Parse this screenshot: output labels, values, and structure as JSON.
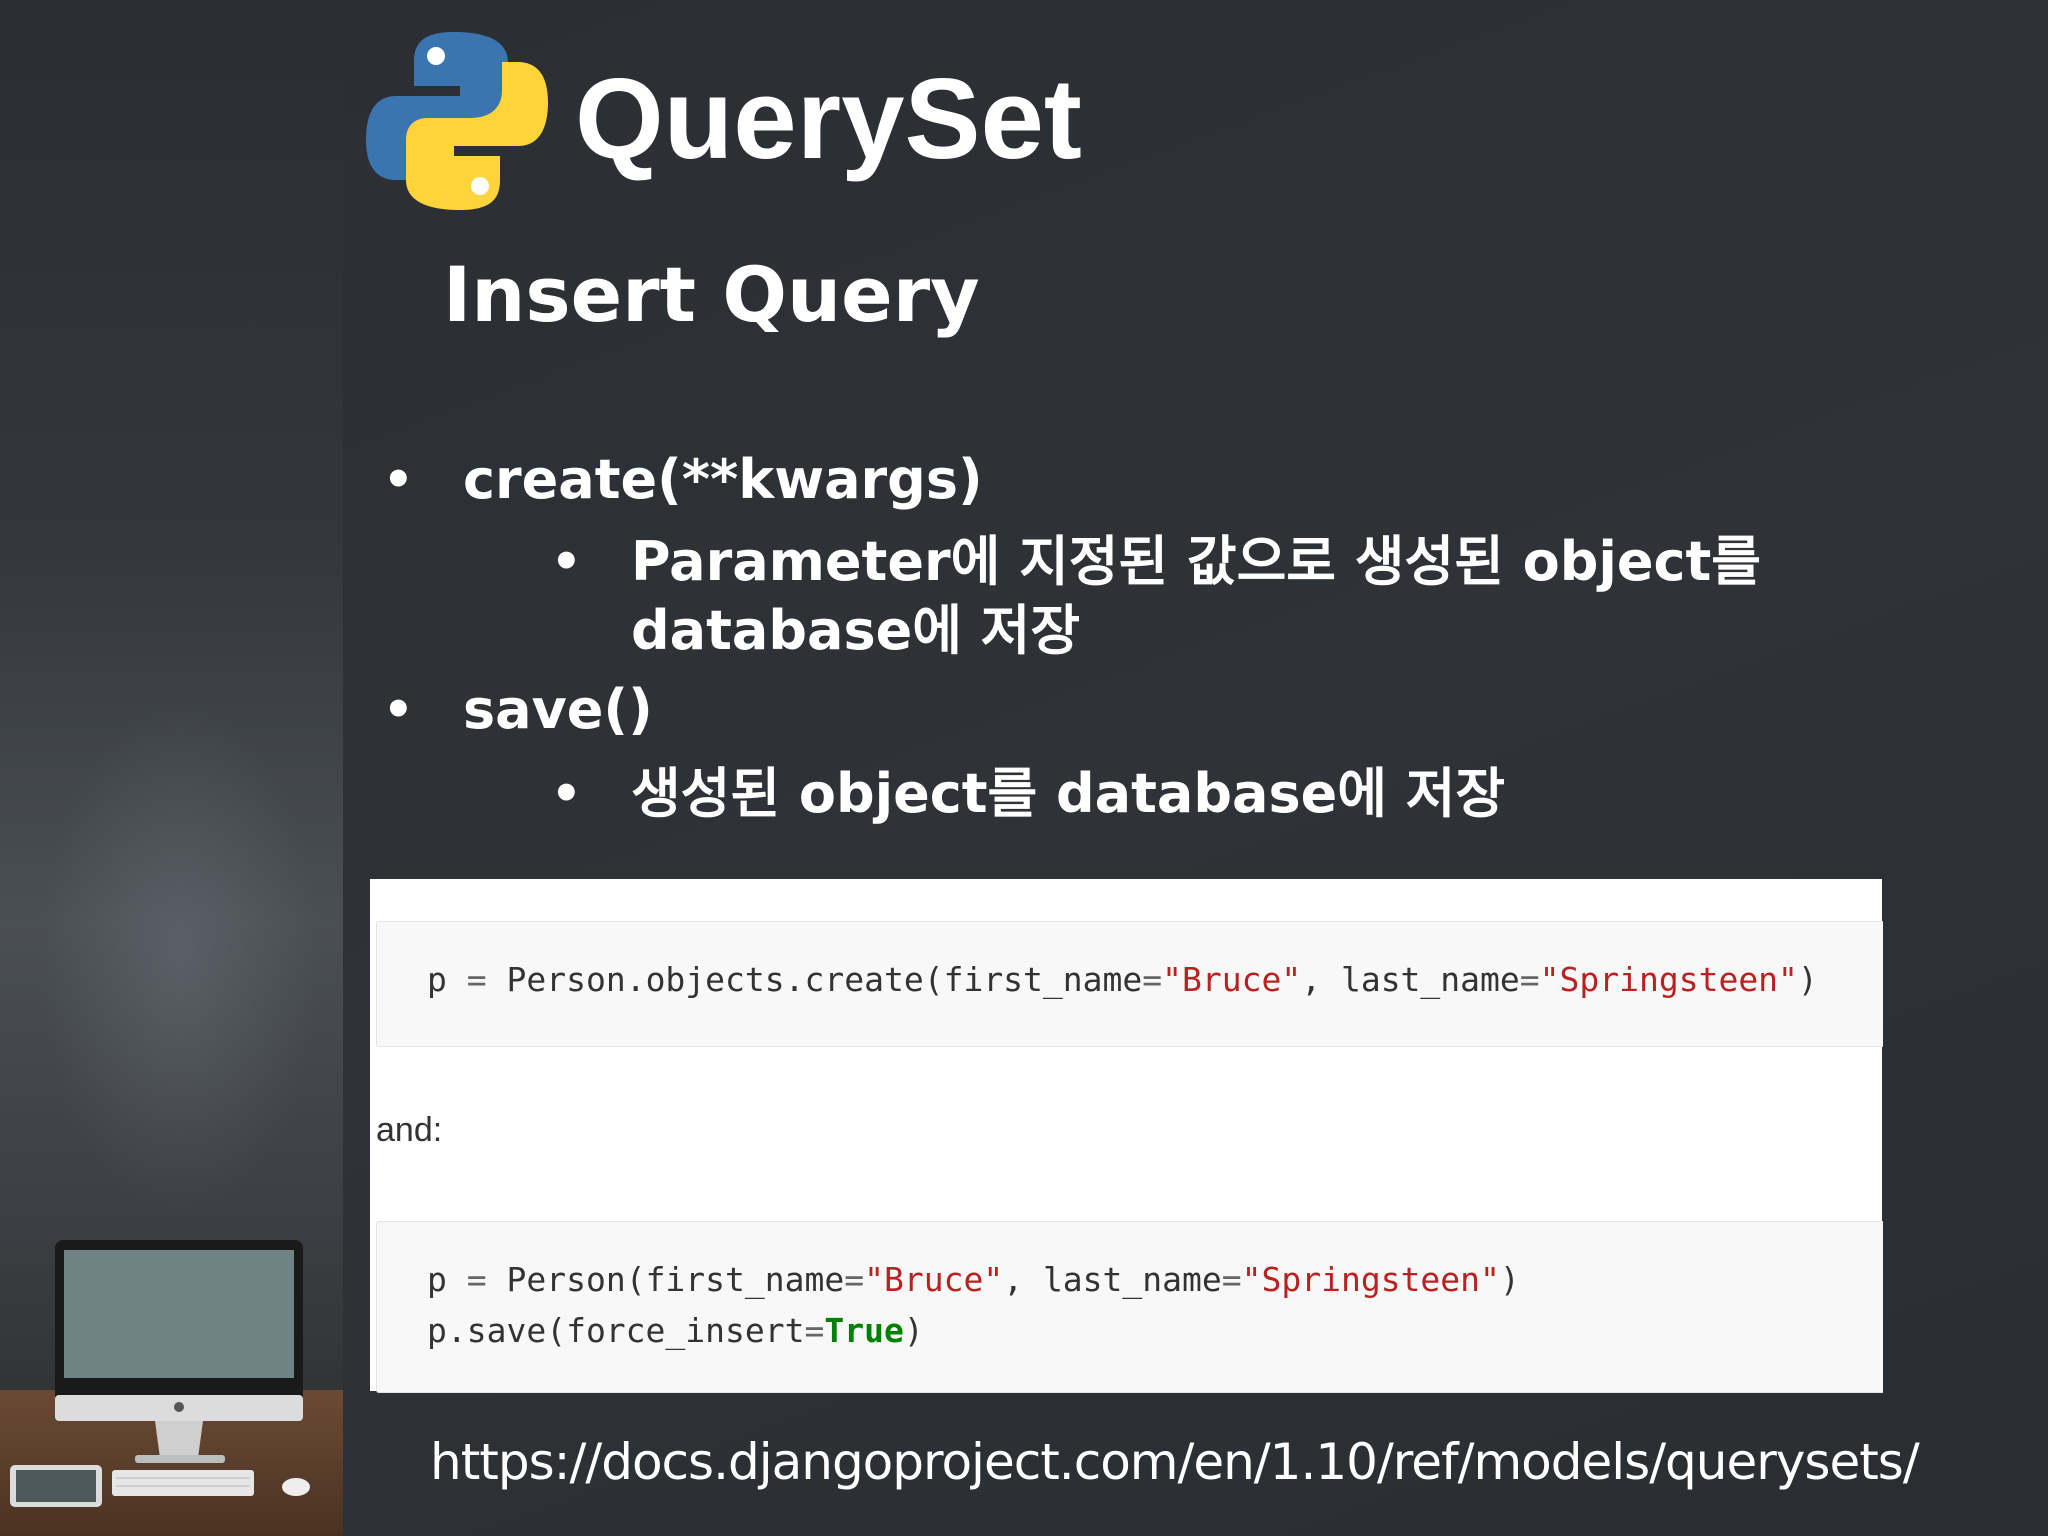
{
  "slide": {
    "title": "QuerySet",
    "subtitle": "Insert Query",
    "logo_icon": "python-logo-icon",
    "illustration_icon": "desktop-computer-icon"
  },
  "bullets": [
    {
      "text": "create(**kwargs)",
      "sub": [
        "Parameter에 지정된 값으로 생성된 object를",
        "database에 저장"
      ]
    },
    {
      "text": "save()",
      "sub": [
        "생성된 object를 database에 저장"
      ]
    }
  ],
  "bullet_glyph": "•",
  "code": {
    "block1": {
      "prefix": "p ",
      "eq": "=",
      "call": " Person.objects.create(first_name",
      "eq2": "=",
      "str1": "\"Bruce\"",
      "mid": ", last_name",
      "eq3": "=",
      "str2": "\"Springsteen\"",
      "end": ")"
    },
    "and_label": "and:",
    "block2": {
      "line1": {
        "prefix": "p ",
        "eq": "=",
        "call": " Person(first_name",
        "eq2": "=",
        "str1": "\"Bruce\"",
        "mid": ", last_name",
        "eq3": "=",
        "str2": "\"Springsteen\"",
        "end": ")"
      },
      "line2": {
        "call": "p.save(force_insert",
        "eq": "=",
        "kw": "True",
        "end": ")"
      }
    }
  },
  "source_url": "https://docs.djangoproject.com/en/1.10/ref/models/querysets/",
  "colors": {
    "background": "#2c3036",
    "text": "#ffffff",
    "code_string": "#ba2121",
    "code_keyword": "#008000",
    "python_blue": "#3a75b0",
    "python_yellow": "#ffd43b"
  }
}
